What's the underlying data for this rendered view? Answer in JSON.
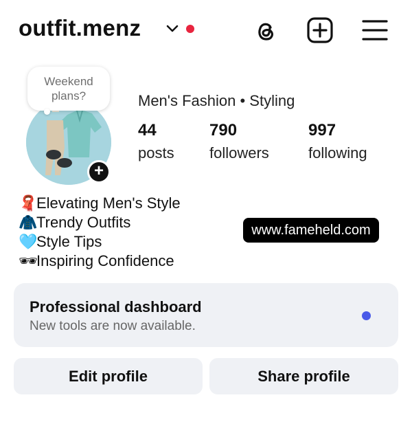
{
  "header": {
    "username": "outfit.menz",
    "icons": [
      "chevron-down-icon",
      "notification-dot",
      "threads-icon",
      "new-post-icon",
      "menu-icon"
    ],
    "accent_red": "#e8253f"
  },
  "profile": {
    "note": "Weekend plans?",
    "category": "Men's Fashion • Styling",
    "stats": {
      "posts": {
        "value": "44",
        "label": "posts"
      },
      "followers": {
        "value": "790",
        "label": "followers"
      },
      "following": {
        "value": "997",
        "label": "following"
      }
    }
  },
  "bio": {
    "lines": [
      {
        "emoji": "🧣",
        "text": "Elevating Men's Style"
      },
      {
        "emoji": "🧥",
        "text": "Trendy Outfits"
      },
      {
        "emoji": "🩵",
        "text": "Style Tips"
      },
      {
        "emoji": "🕶",
        "text": "Inspiring Confidence"
      }
    ],
    "link": "www.fameheld.com"
  },
  "dashboard": {
    "title": "Professional dashboard",
    "subtitle": "New tools are now available.",
    "dot_color": "#4a5ae8"
  },
  "actions": {
    "edit": "Edit profile",
    "share": "Share profile"
  }
}
